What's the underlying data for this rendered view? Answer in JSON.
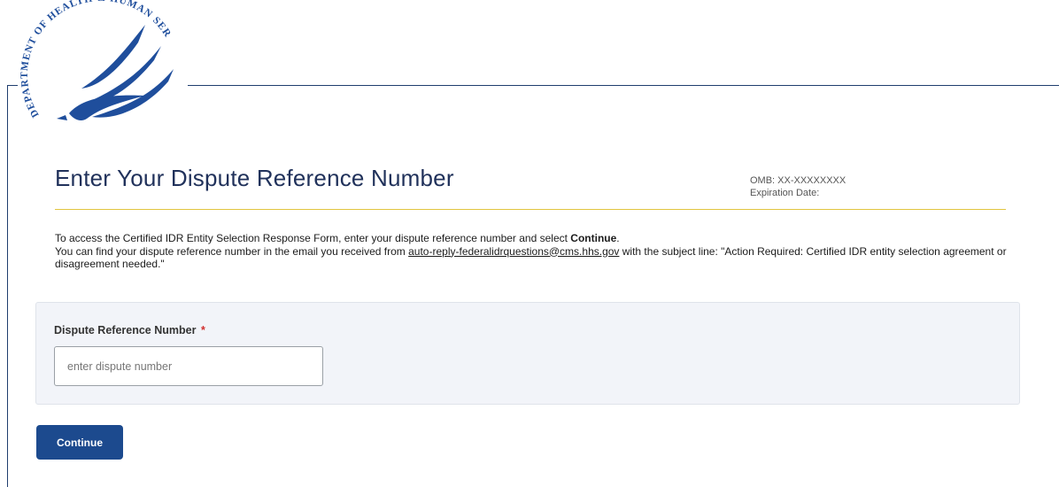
{
  "header": {
    "logo_text": "DEPARTMENT OF HEALTH & HUMAN SERVICES·USA",
    "logo_icon": "hhs-eagle-seal-icon"
  },
  "page": {
    "title": "Enter Your Dispute Reference Number",
    "omb_label": "OMB: XX-XXXXXXXX",
    "expiration_label": "Expiration Date:"
  },
  "intro": {
    "line1_text": "To access the Certified IDR Entity Selection Response Form, enter your dispute reference number and select ",
    "line1_bold": "Continue",
    "line1_end": ".",
    "line2_before": "You can find your dispute reference number in the email you received from ",
    "email_link": "auto-reply-federalidrquestions@cms.hhs.gov",
    "line2_after": " with the subject line: \"Action Required: Certified IDR entity selection agreement or disagreement needed.\""
  },
  "form": {
    "field_label": "Dispute Reference Number",
    "required_marker": "*",
    "input_value": "",
    "input_placeholder": "enter dispute number"
  },
  "actions": {
    "continue_label": "Continue"
  },
  "colors": {
    "title": "#21325b",
    "rule": "#e1c540",
    "button": "#1c4a8e",
    "card": "#f2f4f9",
    "seal_blue": "#1f4e9c"
  }
}
